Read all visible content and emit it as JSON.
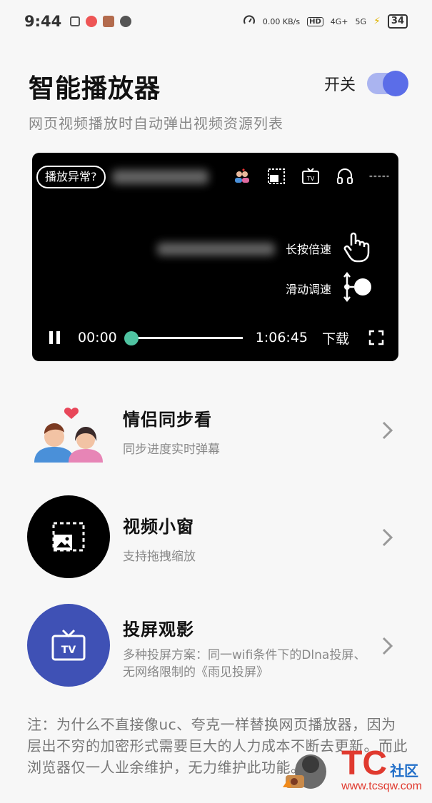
{
  "status_bar": {
    "time": "9:44",
    "net_speed": "0.00 KB/s",
    "hd": "HD",
    "sig1": "4G+",
    "sig2": "5G",
    "battery": "34"
  },
  "header": {
    "title": "智能播放器",
    "subtitle": "网页视频播放时自动弹出视频资源列表",
    "toggle_label": "开关",
    "toggle_on": true
  },
  "player": {
    "error_button": "播放异常?",
    "long_press": "长按倍速",
    "swipe": "滑动调速",
    "current_time": "00:00",
    "total_time": "1:06:45",
    "download": "下载",
    "progress": 0.0
  },
  "features": [
    {
      "title": "情侣同步看",
      "desc": "同步进度实时弹幕",
      "icon": "couple-icon"
    },
    {
      "title": "视频小窗",
      "desc": "支持拖拽缩放",
      "icon": "mini-window-icon"
    },
    {
      "title": "投屏观影",
      "desc": "多种投屏方案：同一wifi条件下的Dlna投屏、无网络限制的《雨见投屏》",
      "icon": "tv-cast-icon"
    }
  ],
  "note": "注：为什么不直接像uc、夸克一样替换网页播放器，因为层出不穷的加密形式需要巨大的人力成本不断去更新。而此浏览器仅一人业余维护，无力维护此功能。",
  "watermark": {
    "logo": "TC",
    "sub": "社区",
    "url": "www.tcsqw.com"
  },
  "colors": {
    "accent": "#5b6de8",
    "teal": "#4fc3a1",
    "feature_blue": "#3f51b5"
  }
}
